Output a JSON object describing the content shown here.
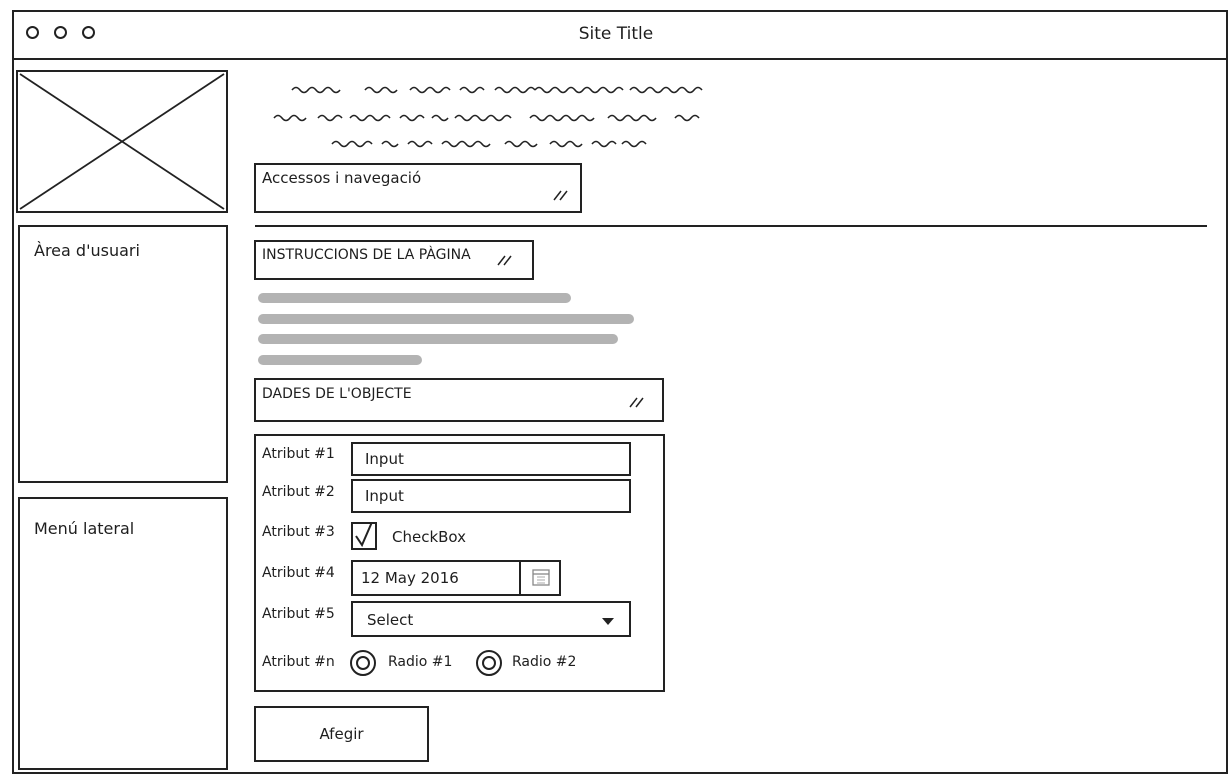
{
  "window": {
    "title": "Site Title"
  },
  "sidebar": {
    "user_area_label": "Àrea d'usuari",
    "side_menu_label": "Menú lateral"
  },
  "main": {
    "navigation_box_label": "Accessos i navegació",
    "instructions_label": "INSTRUCCIONS DE LA PÀGINA",
    "object_data_label": "DADES DE L'OBJECTE",
    "form": {
      "attr1_label": "Atribut #1",
      "attr1_value": "Input",
      "attr2_label": "Atribut #2",
      "attr2_value": "Input",
      "attr3_label": "Atribut #3",
      "attr3_checkbox_label": "CheckBox",
      "attr3_checked": true,
      "attr4_label": "Atribut #4",
      "attr4_date": "12 May 2016",
      "attr5_label": "Atribut #5",
      "attr5_select": "Select",
      "attrn_label": "Atribut #n",
      "radio1_label": "Radio #1",
      "radio2_label": "Radio #2"
    },
    "add_button_label": "Afegir"
  },
  "colors": {
    "ink": "#222222",
    "placeholder_bar": "#b3b3b3"
  },
  "icons": [
    "image-placeholder-icon",
    "resize-icon",
    "check-icon",
    "calendar-icon",
    "dropdown-arrow-icon",
    "radio-icon"
  ]
}
